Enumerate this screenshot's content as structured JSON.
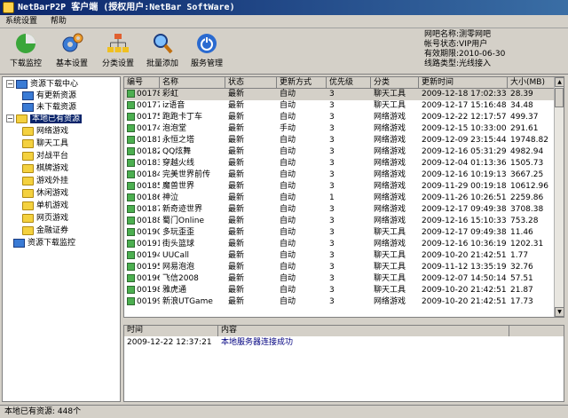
{
  "window": {
    "title": "NetBarP2P 客户端 (授权用户:NetBar SoftWare)"
  },
  "menu": [
    "系统设置",
    "帮助"
  ],
  "toolbar": {
    "buttons": [
      "下载监控",
      "基本设置",
      "分类设置",
      "批量添加",
      "服务管理"
    ]
  },
  "info": {
    "lines": [
      "网吧名称:测零网吧",
      "帐号状态:VIP用户",
      "有效期限:2010-06-30",
      "线路类型:光线接入"
    ]
  },
  "tree": {
    "download_center": "资源下载中心",
    "has_update": "有更新资源",
    "not_downloaded": "未下载资源",
    "local": "本地已有资源",
    "categories": [
      "网络游戏",
      "聊天工具",
      "对战平台",
      "棋牌游戏",
      "游戏外挂",
      "休闲游戏",
      "单机游戏",
      "网页游戏",
      "金融证券"
    ],
    "monitor": "资源下载监控"
  },
  "table": {
    "columns": [
      "编号",
      "名称",
      "状态",
      "更新方式",
      "优先级",
      "分类",
      "更新时间",
      "大小(MB)"
    ],
    "rows": [
      [
        "00178",
        "彩虹",
        "最新",
        "自动",
        "3",
        "聊天工具",
        "2009-12-18 17:02:33",
        "28.39"
      ],
      [
        "00177",
        "iz语音",
        "最新",
        "自动",
        "3",
        "聊天工具",
        "2009-12-17 15:16:48",
        "34.48"
      ],
      [
        "00175",
        "跑跑卡丁车",
        "最新",
        "自动",
        "3",
        "网络游戏",
        "2009-12-22 12:17:57",
        "499.37"
      ],
      [
        "00174",
        "泡泡堂",
        "最新",
        "手动",
        "3",
        "网络游戏",
        "2009-12-15 10:33:00",
        "291.61"
      ],
      [
        "00181",
        "永恒之塔",
        "最新",
        "自动",
        "3",
        "网络游戏",
        "2009-12-09 23:15:44",
        "19748.82"
      ],
      [
        "00182",
        "QQ炫舞",
        "最新",
        "自动",
        "3",
        "网络游戏",
        "2009-12-16 05:31:29",
        "4982.94"
      ],
      [
        "00183",
        "穿越火线",
        "最新",
        "自动",
        "3",
        "网络游戏",
        "2009-12-04 01:13:36",
        "1505.73"
      ],
      [
        "00184",
        "完美世界前传",
        "最新",
        "自动",
        "3",
        "网络游戏",
        "2009-12-16 10:19:13",
        "3667.25"
      ],
      [
        "00185",
        "魔兽世界",
        "最新",
        "自动",
        "3",
        "网络游戏",
        "2009-11-29 00:19:18",
        "10612.96"
      ],
      [
        "00186",
        "神泣",
        "最新",
        "自动",
        "1",
        "网络游戏",
        "2009-11-26 10:26:51",
        "2259.86"
      ],
      [
        "00187",
        "新奇迹世界",
        "最新",
        "自动",
        "3",
        "网络游戏",
        "2009-12-17 09:49:38",
        "3708.38"
      ],
      [
        "00188",
        "蜀门Online",
        "最新",
        "自动",
        "3",
        "网络游戏",
        "2009-12-16 15:10:33",
        "753.28"
      ],
      [
        "00190",
        "多玩歪歪",
        "最新",
        "自动",
        "3",
        "聊天工具",
        "2009-12-17 09:49:38",
        "11.46"
      ],
      [
        "00191",
        "街头篮球",
        "最新",
        "自动",
        "3",
        "网络游戏",
        "2009-12-16 10:36:19",
        "1202.31"
      ],
      [
        "00194",
        "UUCall",
        "最新",
        "自动",
        "3",
        "聊天工具",
        "2009-10-20 21:42:51",
        "1.77"
      ],
      [
        "00195",
        "网易泡泡",
        "最新",
        "自动",
        "3",
        "聊天工具",
        "2009-11-12 13:35:19",
        "32.76"
      ],
      [
        "00196",
        "飞信2008",
        "最新",
        "自动",
        "3",
        "聊天工具",
        "2009-12-07 14:50:14",
        "57.51"
      ],
      [
        "00198",
        "雅虎通",
        "最新",
        "自动",
        "3",
        "聊天工具",
        "2009-10-20 21:42:51",
        "21.87"
      ],
      [
        "00199",
        "新浪UTGame",
        "最新",
        "自动",
        "3",
        "网络游戏",
        "2009-10-20 21:42:51",
        "17.73"
      ]
    ]
  },
  "log": {
    "columns": [
      "时间",
      "内容"
    ],
    "time": "2009-12-22 12:37:21",
    "content": "本地服务器连接成功"
  },
  "status": {
    "text": "本地已有资源: 448个"
  }
}
